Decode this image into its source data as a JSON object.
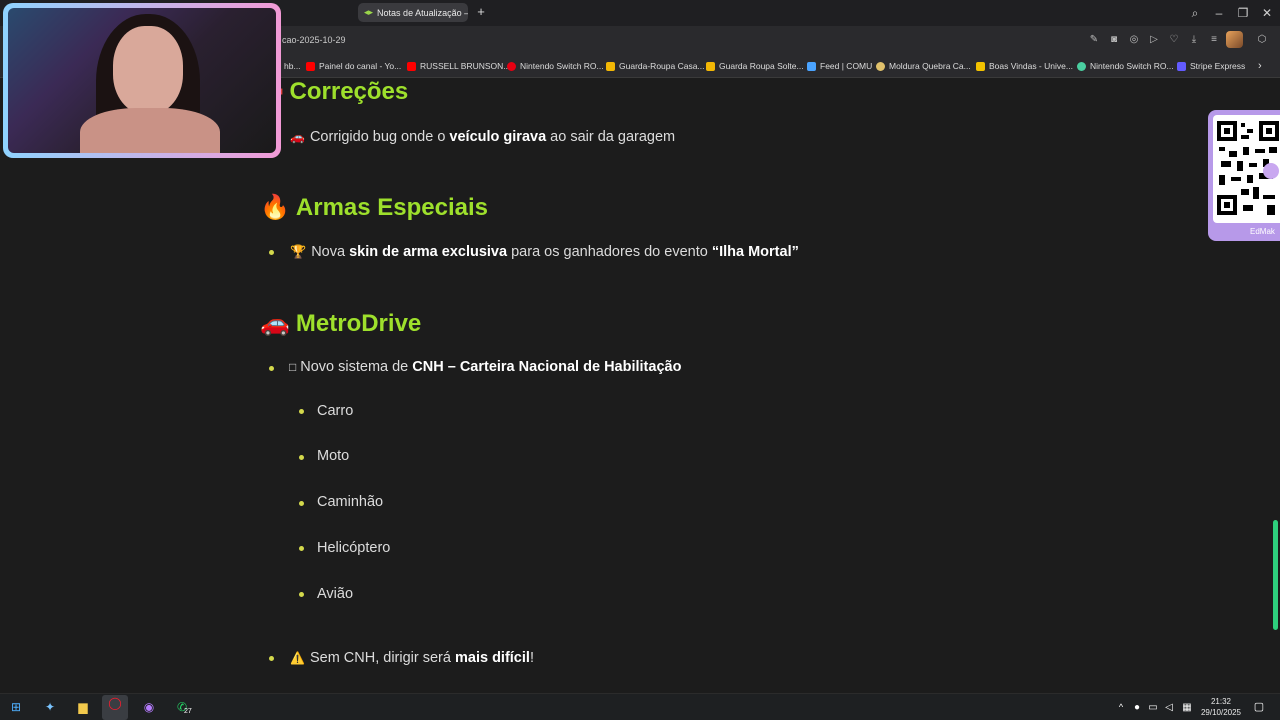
{
  "browser": {
    "tab_title": "Notas de Atualização — ",
    "new_tab": "+",
    "address_text": "cao-2025-10-29",
    "bookmarks": [
      {
        "label": "hb...",
        "color": "#888"
      },
      {
        "label": "Painel do canal - Yo...",
        "color": "#ff0000"
      },
      {
        "label": "RUSSELL BRUNSON...",
        "color": "#ff0000"
      },
      {
        "label": "Nintendo Switch RO...",
        "color": "#e60012"
      },
      {
        "label": "Guarda-Roupa Casa...",
        "color": "#f2b705"
      },
      {
        "label": "Guarda Roupa Solte...",
        "color": "#f2b705"
      },
      {
        "label": "Feed | COMU",
        "color": "#4aa3ff"
      },
      {
        "label": "Moldura Quebra Ca...",
        "color": "#e0c16b"
      },
      {
        "label": "Boas Vindas - Unive...",
        "color": "#f2c200"
      },
      {
        "label": "Nintendo Switch RO...",
        "color": "#4acfa0"
      },
      {
        "label": "Stripe Express",
        "color": "#635bff"
      }
    ]
  },
  "content": {
    "sections": [
      {
        "icon": "wrench-icon",
        "title": "Correções",
        "items": [
          {
            "emoji": "🚗",
            "pre": "Corrigido bug onde o ",
            "bold": "veículo girava",
            "post": " ao sair da garagem"
          }
        ]
      },
      {
        "icon": "fire-icon",
        "emoji": "🔥",
        "title": "Armas Especiais",
        "items": [
          {
            "emoji": "🏆",
            "pre": "Nova ",
            "bold": "skin de arma exclusiva",
            "post": " para os ganhadores do evento ",
            "bold2": "“Ilha Mortal”"
          }
        ]
      },
      {
        "icon": "car-icon",
        "emoji": "🚗",
        "title": "MetroDrive",
        "items": [
          {
            "emoji": "□",
            "pre": "Novo sistema de ",
            "bold": "CNH – Carteira Nacional de Habilitação",
            "post": ""
          }
        ],
        "subitems": [
          "Carro",
          "Moto",
          "Caminhão",
          "Helicóptero",
          "Avião"
        ],
        "warning": {
          "emoji": "⚠️",
          "pre": "Sem CNH, dirigir será ",
          "bold": "mais difícil",
          "post": "!"
        }
      }
    ]
  },
  "qr_label": "EdMak",
  "taskbar": {
    "time": "21:32",
    "date": "29/10/2025",
    "whatsapp_badge": "27"
  }
}
